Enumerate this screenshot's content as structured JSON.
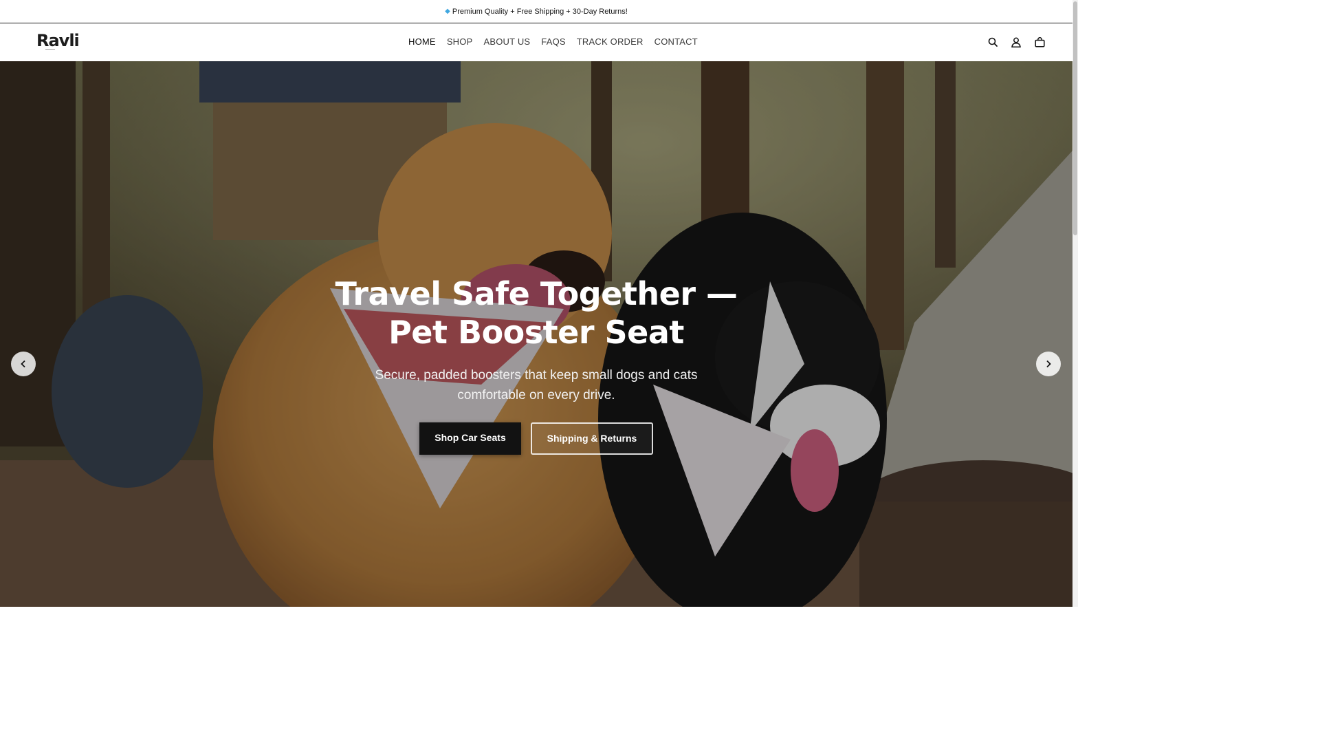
{
  "announcement": {
    "icon": "gem-icon",
    "text": "Premium Quality + Free Shipping + 30-Day Returns!"
  },
  "header": {
    "logo": "Ravli",
    "nav": [
      {
        "label": "HOME",
        "active": true
      },
      {
        "label": "SHOP"
      },
      {
        "label": "ABOUT US"
      },
      {
        "label": "FAQS"
      },
      {
        "label": "TRACK ORDER"
      },
      {
        "label": "CONTACT"
      }
    ],
    "icons": [
      "search-icon",
      "account-icon",
      "cart-icon"
    ]
  },
  "hero": {
    "title": "Travel Safe Together — Pet Booster Seat",
    "subtitle": "Secure, padded boosters that keep small dogs and cats comfortable on every drive.",
    "primary_button": "Shop Car Seats",
    "secondary_button": "Shipping & Returns",
    "prev_icon": "chevron-left-icon",
    "next_icon": "chevron-right-icon"
  },
  "colors": {
    "text": "#121212",
    "button_dark": "#121212",
    "white": "#ffffff"
  }
}
